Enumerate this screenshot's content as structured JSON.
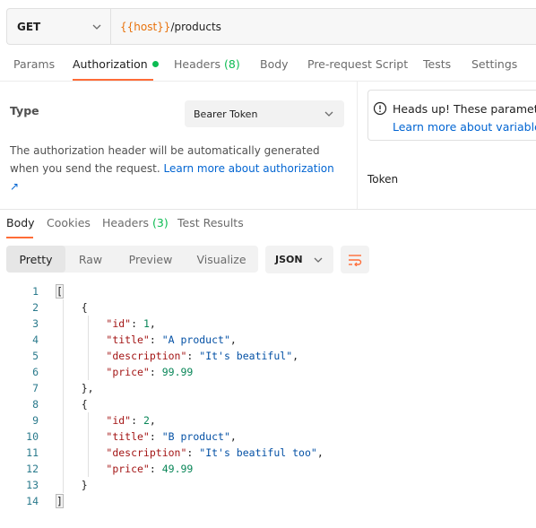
{
  "request": {
    "method": "GET",
    "url_var": "{{host}}",
    "url_path": "/products"
  },
  "request_tabs": [
    {
      "label": "Params"
    },
    {
      "label": "Authorization",
      "active": true,
      "dot": true
    },
    {
      "label": "Headers",
      "count": "(8)"
    },
    {
      "label": "Body"
    },
    {
      "label": "Pre-request Script"
    },
    {
      "label": "Tests"
    },
    {
      "label": "Settings"
    }
  ],
  "authorization": {
    "type_label": "Type",
    "type_value": "Bearer Token",
    "description": "The authorization header will be automatically generated when you send the request.",
    "learn_more": "Learn more about authorization ↗",
    "callout_title": "Heads up! These parameters",
    "callout_link": "Learn more about variables",
    "token_label": "Token"
  },
  "response_tabs": [
    {
      "label": "Body",
      "active": true
    },
    {
      "label": "Cookies"
    },
    {
      "label": "Headers",
      "count": "(3)"
    },
    {
      "label": "Test Results"
    }
  ],
  "view_modes": [
    {
      "label": "Pretty",
      "active": true
    },
    {
      "label": "Raw"
    },
    {
      "label": "Preview"
    },
    {
      "label": "Visualize"
    }
  ],
  "format": "JSON",
  "code_lines": [
    [
      {
        "t": "p",
        "v": "["
      }
    ],
    [
      {
        "t": "p",
        "v": "    {"
      }
    ],
    [
      {
        "t": "p",
        "v": "        "
      },
      {
        "t": "k",
        "v": "\"id\""
      },
      {
        "t": "p",
        "v": ": "
      },
      {
        "t": "n",
        "v": "1"
      },
      {
        "t": "p",
        "v": ","
      }
    ],
    [
      {
        "t": "p",
        "v": "        "
      },
      {
        "t": "k",
        "v": "\"title\""
      },
      {
        "t": "p",
        "v": ": "
      },
      {
        "t": "s",
        "v": "\"A product\""
      },
      {
        "t": "p",
        "v": ","
      }
    ],
    [
      {
        "t": "p",
        "v": "        "
      },
      {
        "t": "k",
        "v": "\"description\""
      },
      {
        "t": "p",
        "v": ": "
      },
      {
        "t": "s",
        "v": "\"It's beatiful\""
      },
      {
        "t": "p",
        "v": ","
      }
    ],
    [
      {
        "t": "p",
        "v": "        "
      },
      {
        "t": "k",
        "v": "\"price\""
      },
      {
        "t": "p",
        "v": ": "
      },
      {
        "t": "n",
        "v": "99.99"
      }
    ],
    [
      {
        "t": "p",
        "v": "    },"
      }
    ],
    [
      {
        "t": "p",
        "v": "    {"
      }
    ],
    [
      {
        "t": "p",
        "v": "        "
      },
      {
        "t": "k",
        "v": "\"id\""
      },
      {
        "t": "p",
        "v": ": "
      },
      {
        "t": "n",
        "v": "2"
      },
      {
        "t": "p",
        "v": ","
      }
    ],
    [
      {
        "t": "p",
        "v": "        "
      },
      {
        "t": "k",
        "v": "\"title\""
      },
      {
        "t": "p",
        "v": ": "
      },
      {
        "t": "s",
        "v": "\"B product\""
      },
      {
        "t": "p",
        "v": ","
      }
    ],
    [
      {
        "t": "p",
        "v": "        "
      },
      {
        "t": "k",
        "v": "\"description\""
      },
      {
        "t": "p",
        "v": ": "
      },
      {
        "t": "s",
        "v": "\"It's beatiful too\""
      },
      {
        "t": "p",
        "v": ","
      }
    ],
    [
      {
        "t": "p",
        "v": "        "
      },
      {
        "t": "k",
        "v": "\"price\""
      },
      {
        "t": "p",
        "v": ": "
      },
      {
        "t": "n",
        "v": "49.99"
      }
    ],
    [
      {
        "t": "p",
        "v": "    }"
      }
    ],
    [
      {
        "t": "p",
        "v": "]"
      }
    ]
  ],
  "colors": {
    "accent": "#ff6c37",
    "link": "#0265d2",
    "variable": "#e8720c",
    "success": "#0cbb52"
  }
}
